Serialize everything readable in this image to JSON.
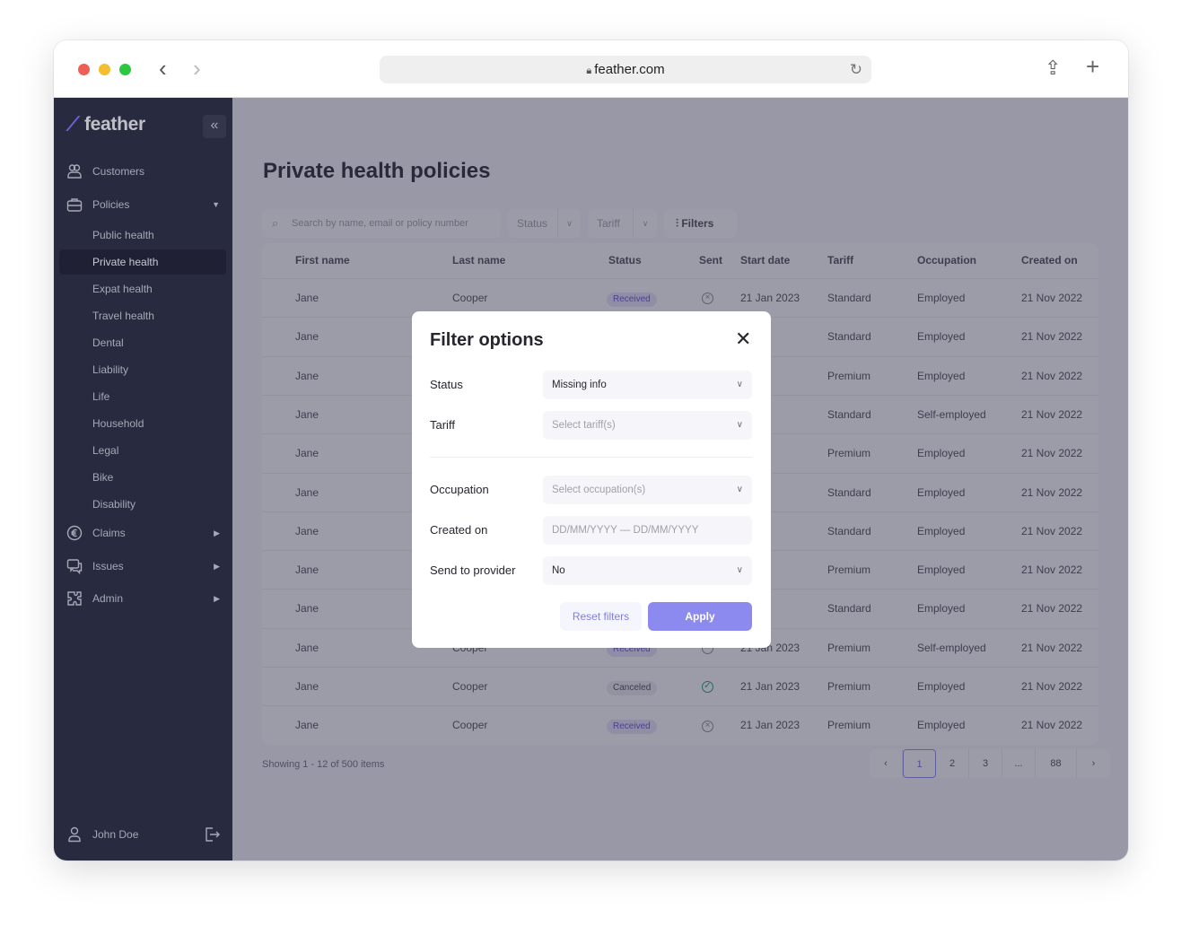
{
  "browser": {
    "url": "feather.com"
  },
  "sidebar": {
    "logo": "feather",
    "items": [
      {
        "label": "Customers",
        "icon": "users-icon"
      },
      {
        "label": "Policies",
        "icon": "briefcase-icon"
      },
      {
        "label": "Claims",
        "icon": "euro-icon"
      },
      {
        "label": "Issues",
        "icon": "chat-icon"
      },
      {
        "label": "Admin",
        "icon": "puzzle-icon"
      }
    ],
    "subitems": [
      "Public health",
      "Private health",
      "Expat health",
      "Travel health",
      "Dental",
      "Liability",
      "Life",
      "Household",
      "Legal",
      "Bike",
      "Disability"
    ],
    "active_subitem": "Private health",
    "user": "John Doe"
  },
  "main": {
    "title": "Private health policies",
    "search_placeholder": "Search by name, email or policy number",
    "status_filter": "Status",
    "tariff_filter": "Tariff",
    "filters_label": "Filters",
    "columns": [
      "First name",
      "Last name",
      "Status",
      "Sent",
      "Start date",
      "Tariff",
      "Occupation",
      "Created on"
    ],
    "rows": [
      {
        "first": "Jane",
        "last": "Cooper",
        "status": "Received",
        "sent": "no",
        "start": "21 Jan 2023",
        "tariff": "Standard",
        "occupation": "Employed",
        "created": "21 Nov 2022"
      },
      {
        "first": "Jane",
        "last": "",
        "status": "",
        "sent": "",
        "start": "2023",
        "tariff": "Standard",
        "occupation": "Employed",
        "created": "21 Nov 2022"
      },
      {
        "first": "Jane",
        "last": "",
        "status": "",
        "sent": "",
        "start": "2023",
        "tariff": "Premium",
        "occupation": "Employed",
        "created": "21 Nov 2022"
      },
      {
        "first": "Jane",
        "last": "",
        "status": "",
        "sent": "",
        "start": "2023",
        "tariff": "Standard",
        "occupation": "Self-employed",
        "created": "21 Nov 2022"
      },
      {
        "first": "Jane",
        "last": "",
        "status": "",
        "sent": "",
        "start": "2023",
        "tariff": "Premium",
        "occupation": "Employed",
        "created": "21 Nov 2022"
      },
      {
        "first": "Jane",
        "last": "",
        "status": "",
        "sent": "",
        "start": "2023",
        "tariff": "Standard",
        "occupation": "Employed",
        "created": "21 Nov 2022"
      },
      {
        "first": "Jane",
        "last": "",
        "status": "",
        "sent": "",
        "start": "2023",
        "tariff": "Standard",
        "occupation": "Employed",
        "created": "21 Nov 2022"
      },
      {
        "first": "Jane",
        "last": "",
        "status": "",
        "sent": "",
        "start": "2023",
        "tariff": "Premium",
        "occupation": "Employed",
        "created": "21 Nov 2022"
      },
      {
        "first": "Jane",
        "last": "",
        "status": "",
        "sent": "",
        "start": "2023",
        "tariff": "Standard",
        "occupation": "Employed",
        "created": "21 Nov 2022"
      },
      {
        "first": "Jane",
        "last": "Cooper",
        "status": "Received",
        "sent": "no",
        "start": "21 Jan 2023",
        "tariff": "Premium",
        "occupation": "Self-employed",
        "created": "21 Nov 2022"
      },
      {
        "first": "Jane",
        "last": "Cooper",
        "status": "Canceled",
        "sent": "yes",
        "start": "21 Jan 2023",
        "tariff": "Premium",
        "occupation": "Employed",
        "created": "21 Nov 2022"
      },
      {
        "first": "Jane",
        "last": "Cooper",
        "status": "Received",
        "sent": "no",
        "start": "21 Jan 2023",
        "tariff": "Premium",
        "occupation": "Employed",
        "created": "21 Nov 2022"
      }
    ],
    "showing": "Showing 1 - 12 of 500 items",
    "pages": [
      "1",
      "2",
      "3",
      "...",
      "88"
    ],
    "current_page": "1"
  },
  "modal": {
    "title": "Filter options",
    "fields": [
      {
        "label": "Status",
        "value": "Missing info",
        "placeholder": false,
        "dropdown": true
      },
      {
        "label": "Tariff",
        "value": "Select tariff(s)",
        "placeholder": true,
        "dropdown": true
      },
      {
        "label": "Occupation",
        "value": "Select occupation(s)",
        "placeholder": true,
        "dropdown": true
      },
      {
        "label": "Created on",
        "value": "DD/MM/YYYY — DD/MM/YYYY",
        "placeholder": true,
        "dropdown": false
      },
      {
        "label": "Send to provider",
        "value": "No",
        "placeholder": false,
        "dropdown": true
      }
    ],
    "reset_label": "Reset filters",
    "apply_label": "Apply"
  },
  "colors": {
    "accent": "#8d8aef",
    "sidebar": "#282a40",
    "received": "#6b4fd8",
    "sent_ok": "#1aa36b"
  }
}
